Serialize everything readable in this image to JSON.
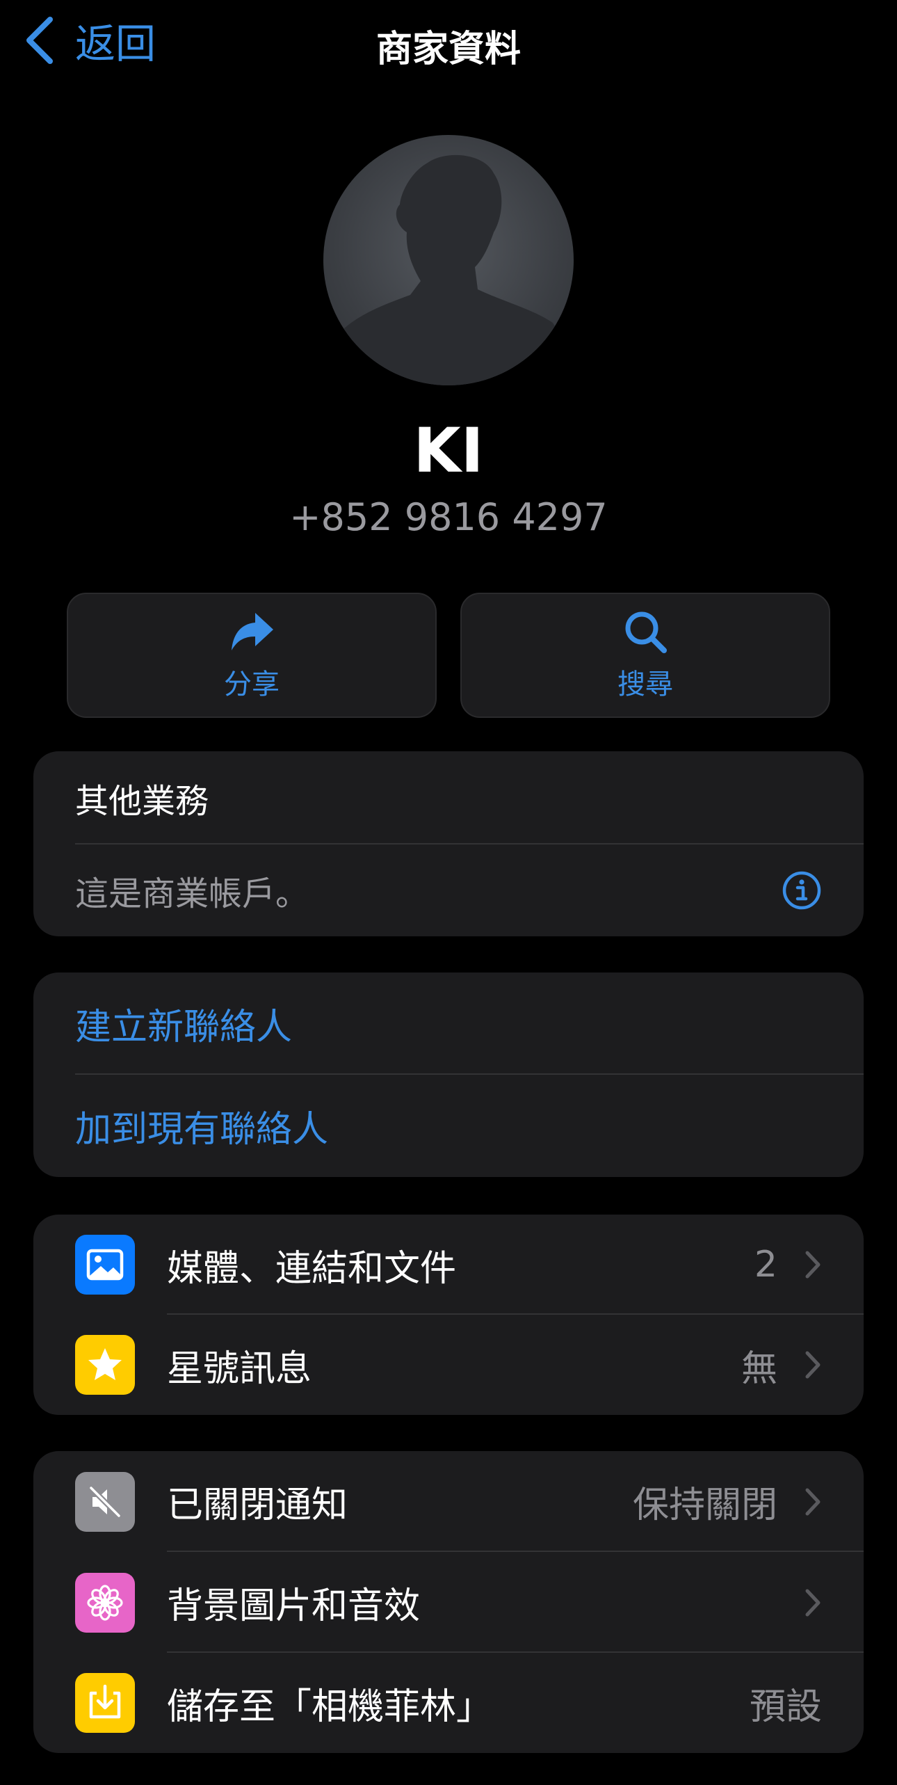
{
  "nav": {
    "back_label": "返回",
    "title": "商家資料"
  },
  "profile": {
    "name": "KI",
    "phone": "+852 9816 4297"
  },
  "actions": [
    {
      "label": "分享",
      "icon": "share-arrow-icon"
    },
    {
      "label": "搜尋",
      "icon": "search-icon"
    }
  ],
  "business": {
    "category": "其他業務",
    "note": "這是商業帳戶。",
    "icon": "info-icon"
  },
  "contacts": {
    "create_new": "建立新聯絡人",
    "add_existing": "加到現有聯絡人"
  },
  "media_section": [
    {
      "label": "媒體、連結和文件",
      "value": "2",
      "icon": "photo-icon",
      "color": "#0a7aff"
    },
    {
      "label": "星號訊息",
      "value": "無",
      "icon": "star-icon",
      "color": "#ffcc00"
    }
  ],
  "settings_section": [
    {
      "label": "已關閉通知",
      "value": "保持關閉",
      "icon": "speaker-muted-icon",
      "color": "#8e8e93"
    },
    {
      "label": "背景圖片和音效",
      "value": "",
      "icon": "flower-icon",
      "color": "#e765c8"
    },
    {
      "label": "儲存至「相機菲林」",
      "value": "預設",
      "icon": "save-download-icon",
      "color": "#ffcc00"
    }
  ],
  "colors": {
    "accent": "#3a8ee6",
    "background": "#000000",
    "card": "#1c1c1e",
    "secondary_text": "#9a9a9f"
  }
}
